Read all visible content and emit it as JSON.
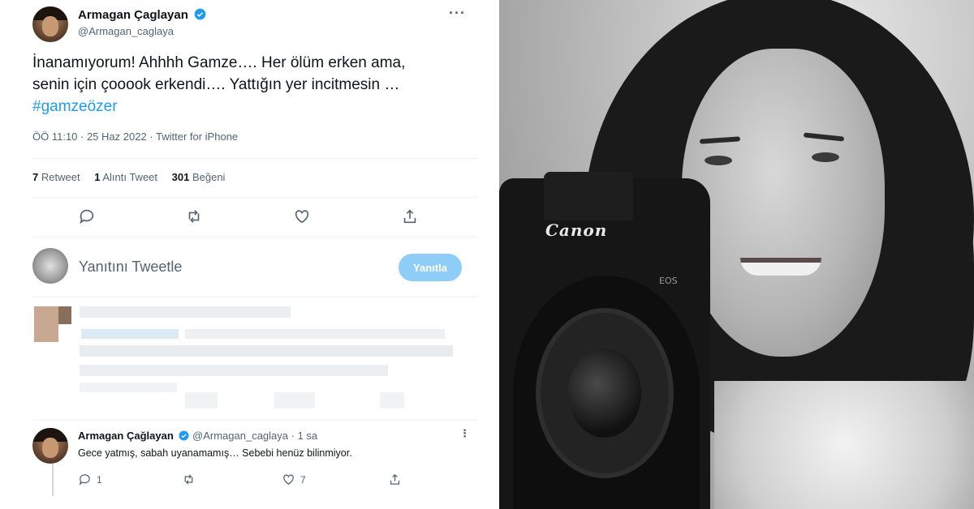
{
  "tweet": {
    "author_name": "Armagan Çaglayan",
    "author_handle": "@Armagan_caglaya",
    "text_line1": "İnanamıyorum! Ahhhh Gamze…. Her ölüm erken ama,",
    "text_line2": "senin için çooook erkendi…. Yattığın yer incitmesin …",
    "hashtag": "#gamzeözer",
    "meta": "ÖÖ 11:10 · 25 Haz 2022 · Twitter for iPhone",
    "retweets_count": "7",
    "retweets_label": "Retweet",
    "quotes_count": "1",
    "quotes_label": "Alıntı Tweet",
    "likes_count": "301",
    "likes_label": "Beğeni"
  },
  "composer": {
    "placeholder": "Yanıtını Tweetle",
    "reply_button": "Yanıtla"
  },
  "reply": {
    "author_name": "Armagan Çağlayan",
    "author_handle": "@Armagan_caglaya",
    "time": "· 1 sa",
    "text": "Gece yatmış, sabah uyanamamış… Sebebi henüz bilinmiyor.",
    "reply_count": "1",
    "like_count": "7"
  },
  "photo": {
    "camera_brand": "Canon",
    "camera_model": "EOS"
  },
  "colors": {
    "accent": "#1d9bf0",
    "reply_button_disabled": "#8ecdf7",
    "muted_text": "#536471"
  }
}
